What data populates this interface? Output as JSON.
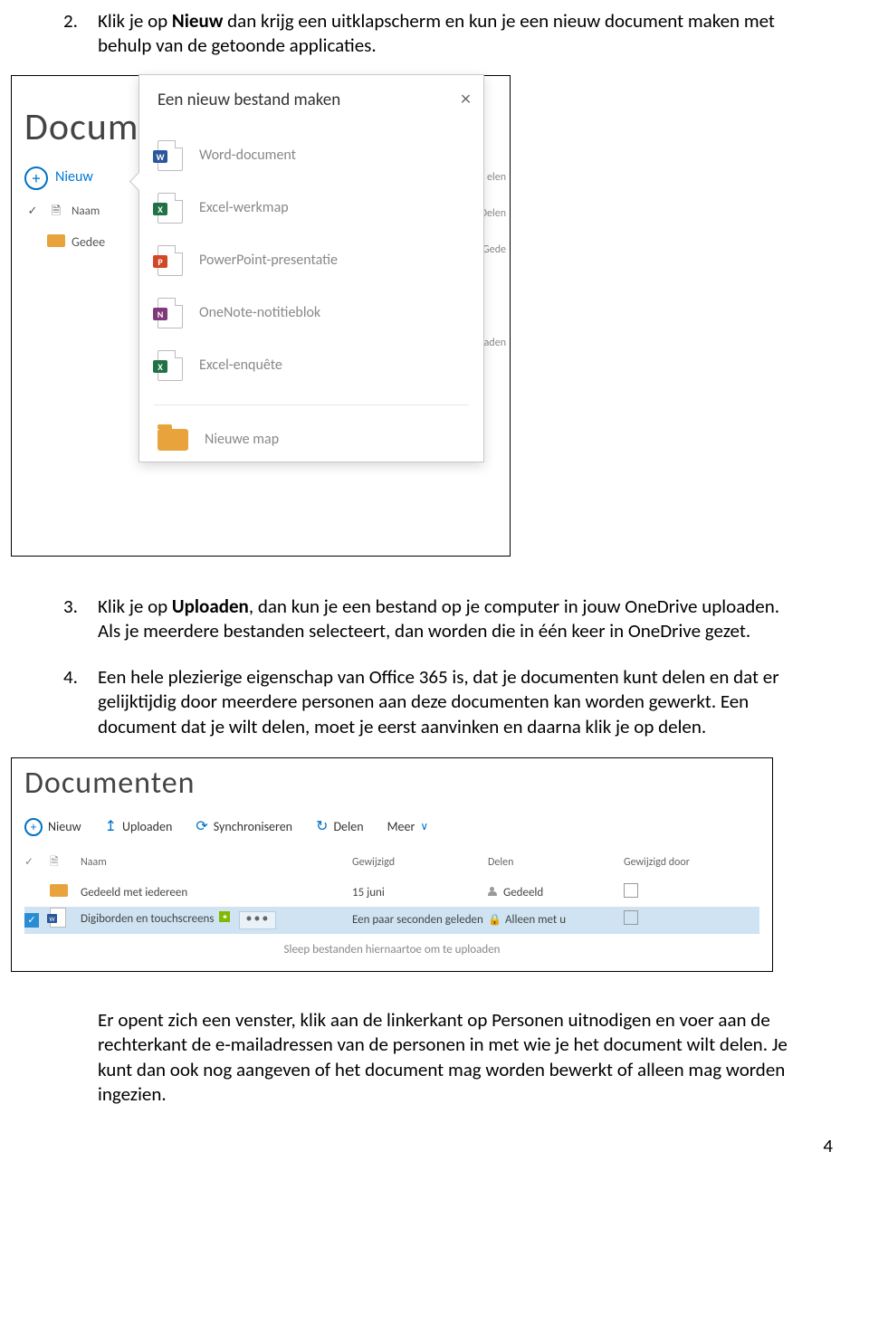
{
  "items": [
    {
      "num": "2.",
      "text_a": "Klik je op ",
      "bold": "Nieuw",
      "text_b": " dan krijg een uitklapscherm en kun je een nieuw document maken met behulp van de getoonde applicaties."
    },
    {
      "num": "3.",
      "text_a": "Klik je op ",
      "bold": "Uploaden",
      "text_b": ", dan kun je een bestand op je computer in jouw OneDrive uploaden. Als je meerdere bestanden selecteert, dan worden die in één keer in OneDrive gezet."
    },
    {
      "num": "4.",
      "text_a": "Een hele plezierige eigenschap van Office 365 is, dat je documenten kunt delen en dat er gelijktijdig door meerdere personen aan deze documenten kan worden gewerkt. Een document dat je wilt delen, moet je eerst aanvinken en daarna klik je op delen.",
      "bold": "",
      "text_b": ""
    }
  ],
  "shot1": {
    "heading": "Docum",
    "nieuw": "Nieuw",
    "col_naam": "Naam",
    "row_gedee": "Gedee",
    "callout_title": "Een nieuw bestand maken",
    "options": [
      "Word-document",
      "Excel-werkmap",
      "PowerPoint-presentatie",
      "OneNote-notitieblok",
      "Excel-enquête",
      "Nieuwe map"
    ],
    "peek": [
      "elen",
      "Delen",
      "Gede",
      "paden"
    ]
  },
  "shot2": {
    "heading": "Documenten",
    "toolbar": [
      "Nieuw",
      "Uploaden",
      "Synchroniseren",
      "Delen",
      "Meer"
    ],
    "cols": [
      "Naam",
      "Gewijzigd",
      "Delen",
      "Gewijzigd door"
    ],
    "row1": {
      "name": "Gedeeld met iedereen",
      "mod": "15 juni",
      "del": "Gedeeld"
    },
    "row2": {
      "name": "Digiborden en touchscreens",
      "mod": "Een paar seconden geleden",
      "del": "Alleen met u"
    },
    "hint": "Sleep bestanden hiernaartoe om te uploaden"
  },
  "tail_a": "Er opent zich een venster, klik aan de linkerkant op ",
  "tail_bold": "Personen uitnodigen",
  "tail_b": " en voer aan de rechterkant de e-mailadressen van de personen in met wie je het document wilt delen. Je kunt dan ook nog aangeven of het document mag worden bewerkt of alleen mag worden ingezien.",
  "page_number": "4"
}
